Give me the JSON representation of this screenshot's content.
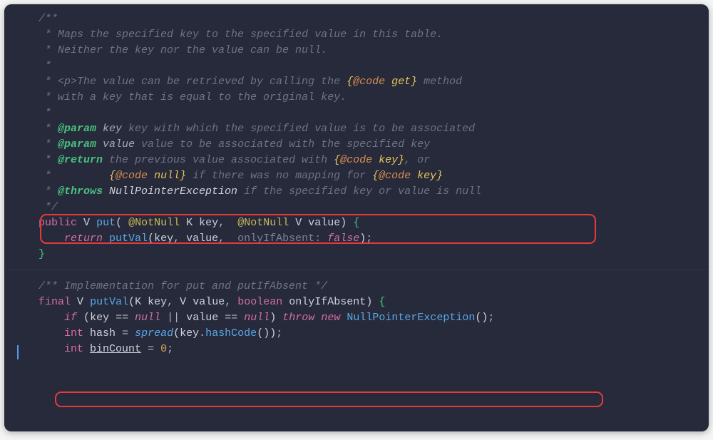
{
  "comment": {
    "open": "/**",
    "l1": " * Maps the specified key to the specified value in this table.",
    "l2": " * Neither the key nor the value can be null.",
    "l3": " *",
    "l4a": " * <p>The value can be retrieved by calling the ",
    "l4b": "{",
    "l4c": "@code",
    "l4d": " get}",
    "l4e": " method",
    "l5": " * with a key that is equal to the original key.",
    "l6": " *",
    "l7star": " * ",
    "l7tag": "@param",
    "l7name": " key ",
    "l7desc": "key with which the specified value is to be associated",
    "l8star": " * ",
    "l8tag": "@param",
    "l8name": " value ",
    "l8desc": "value to be associated with the specified key",
    "l9star": " * ",
    "l9tag": "@return",
    "l9a": " the previous value associated with ",
    "l9b": "{",
    "l9c": "@code",
    "l9d": " key}",
    "l9e": ", or",
    "l10star": " *         ",
    "l10b": "{",
    "l10c": "@code",
    "l10d": " null}",
    "l10e": " if there was no mapping for ",
    "l10f": "{",
    "l10g": "@code",
    "l10h": " key}",
    "l11star": " * ",
    "l11tag": "@throws",
    "l11exc": " NullPointerException",
    "l11desc": " if the specified key or value is null",
    "close": " */",
    "impl": "/** Implementation for put and putIfAbsent */"
  },
  "code": {
    "public": "public",
    "V": "V",
    "put": "put",
    "ann": "@NotNull",
    "K": "K",
    "key": "key",
    "value": "value",
    "openBrace": "{",
    "closeBrace": "}",
    "return": "return",
    "putVal": "putVal",
    "hint_onlyIfAbsent": "onlyIfAbsent: ",
    "false": "false",
    "final": "final",
    "boolean": "boolean",
    "onlyIfAbsent": "onlyIfAbsent",
    "if": "if",
    "null": "null",
    "throw": "throw",
    "new": "new",
    "NPE": "NullPointerException",
    "int": "int",
    "hash": "hash",
    "spread": "spread",
    "hashCode": "hashCode",
    "binCount": "binCount",
    "zero": "0",
    "or": "||",
    "eqeq": "==",
    "eq": "=",
    "comma": ",",
    "dot": ".",
    "semi": ";",
    "lparen": "(",
    "rparen": ")"
  }
}
